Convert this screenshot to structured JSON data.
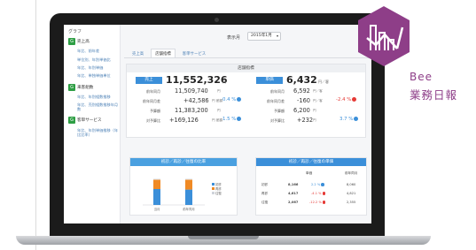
{
  "sidebar": {
    "title": "グラフ",
    "groups": [
      {
        "badge": "G",
        "label": "売上高",
        "items": [
          "年比、前年差",
          "単位別、年別単価比",
          "年比、年別単価",
          "年比、単独単価単位"
        ]
      },
      {
        "badge": "G",
        "label": "来客組数",
        "items": [
          "年比、年別組数推移",
          "年比、売別組数推移年月数"
        ]
      },
      {
        "badge": "G",
        "label": "客単サービス",
        "items": [
          "年比、年別単価推移（年比比率）"
        ]
      }
    ]
  },
  "topbar": {
    "display_label": "表示月",
    "display_value": "2015年1月"
  },
  "tabs": [
    "売上高",
    "店舗指標",
    "客単サービス"
  ],
  "summary": {
    "header": "店舗指標",
    "sales": {
      "badge": "売上",
      "value": "11,552,326",
      "unit": "円",
      "rows": [
        {
          "label": "前年同月",
          "value": "11,509,740",
          "unit": "円"
        },
        {
          "label": "前年同月差",
          "value": "+42,586",
          "unit": "円 差額",
          "pct": "0.4 %",
          "pct_color": "#3b8fd9"
        },
        {
          "label": "予算額",
          "value": "11,383,200",
          "unit": "円"
        },
        {
          "label": "対予算比",
          "value": "+169,126",
          "unit": "円 差額",
          "pct": "1.5 %",
          "pct_color": "#3b8fd9"
        }
      ]
    },
    "unit_price": {
      "badge": "単価",
      "value": "6,432",
      "unit": "円／客",
      "rows": [
        {
          "label": "前年同月",
          "value": "6,592",
          "unit": "円／客"
        },
        {
          "label": "前年同月差",
          "value": "-160",
          "unit": "円／客",
          "pct": "-2.4 %",
          "pct_color": "#e53935"
        },
        {
          "label": "予算額",
          "value": "6,200",
          "unit": "円"
        },
        {
          "label": "対予算比",
          "value": "+232",
          "unit": "円",
          "pct": "3.7 %",
          "pct_color": "#3b8fd9"
        }
      ]
    }
  },
  "bar_panel": {
    "title": "初診／再診／往復の比率",
    "legend": [
      "初診",
      "再診",
      "往復"
    ]
  },
  "chart_data": {
    "type": "bar",
    "stacked": true,
    "title": "初診／再診／往復の比率",
    "categories": [
      "当月",
      "前年同月"
    ],
    "series": [
      {
        "name": "初診",
        "values": [
          60,
          58
        ],
        "color": "#3b8fd9"
      },
      {
        "name": "再診",
        "values": [
          35,
          37
        ],
        "color": "#f08a24"
      },
      {
        "name": "往復",
        "values": [
          5,
          5
        ],
        "color": "#e8ebef"
      }
    ],
    "ylim": [
      0,
      100
    ]
  },
  "table_panel": {
    "title": "初診／再診／往復の単価",
    "columns": [
      "",
      "単価",
      "",
      "前年同月"
    ],
    "rows": [
      {
        "label": "初診",
        "value": "8,166",
        "pct": "2.2 %",
        "pct_color": "#3b8fd9",
        "prev": "8,060"
      },
      {
        "label": "再診",
        "value": "4,617",
        "pct": "-4.1 %",
        "pct_color": "#e53935",
        "prev": "4,821"
      },
      {
        "label": "往復",
        "value": "2,067",
        "pct": "-12.2 %",
        "pct_color": "#e53935",
        "prev": "2,355"
      }
    ]
  },
  "brand": {
    "name": "Bee",
    "subtitle": "業務日報"
  },
  "colors": {
    "accent": "#3b8fd9",
    "brand": "#8e3e88",
    "negative": "#e53935",
    "positive": "#3b8fd9"
  }
}
